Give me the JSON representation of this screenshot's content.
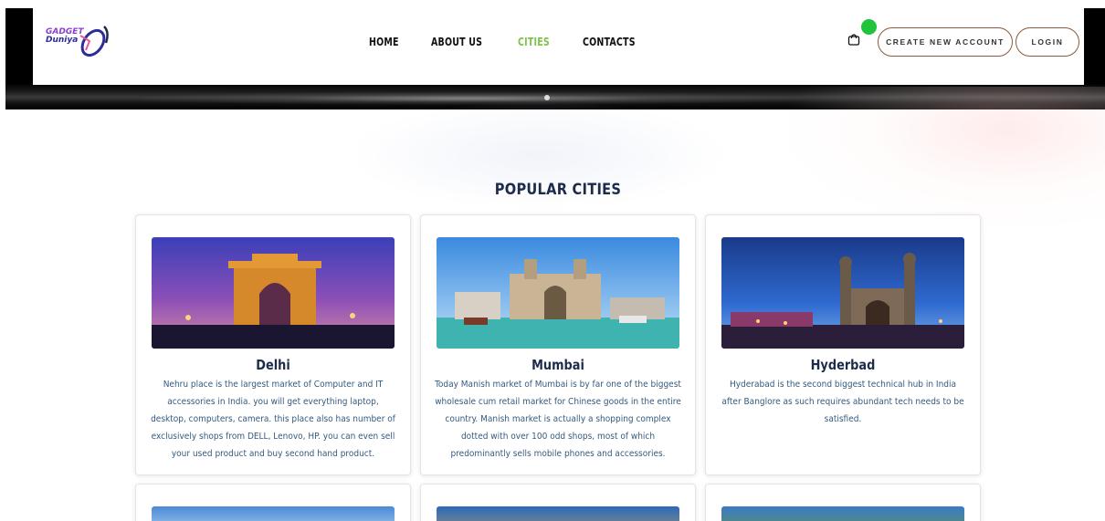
{
  "brand": {
    "line1": "GADGET",
    "line2": "Duniya"
  },
  "nav": {
    "items": [
      {
        "label": "HOME",
        "active": false
      },
      {
        "label": "ABOUT US",
        "active": false
      },
      {
        "label": "CITIES",
        "active": true
      },
      {
        "label": "CONTACTS",
        "active": false
      }
    ]
  },
  "header": {
    "create_account_label": "CREATE NEW ACCOUNT",
    "login_label": "LOGIN",
    "cart_icon": "shopping-bag-icon",
    "badge_color": "#1fc43a"
  },
  "colors": {
    "accent": "#7ec44a",
    "heading": "#1c2b4a",
    "body_text": "#355a7e",
    "button_border": "#8a5a3a"
  },
  "section": {
    "title": "POPULAR CITIES"
  },
  "cities": [
    {
      "name": "Delhi",
      "desc": "Nehru place is the largest market of Computer and IT accessories in India. you will get everything laptop, desktop, computers, camera. this place also has number of exclusively shops from DELL, Lenovo, HP. you can even sell your used product and buy second hand product."
    },
    {
      "name": "Mumbai",
      "desc": "Today Manish market of Mumbai is by far one of the biggest wholesale cum retail market for Chinese goods in the entire country. Manish market is actually a shopping complex dotted with over 100 odd shops, most of which predominantly sells mobile phones and accessories."
    },
    {
      "name": "Hyderbad",
      "desc": "Hyderabad is the second biggest technical hub in India after Banglore as such requires abundant tech needs to be satisfied."
    }
  ]
}
